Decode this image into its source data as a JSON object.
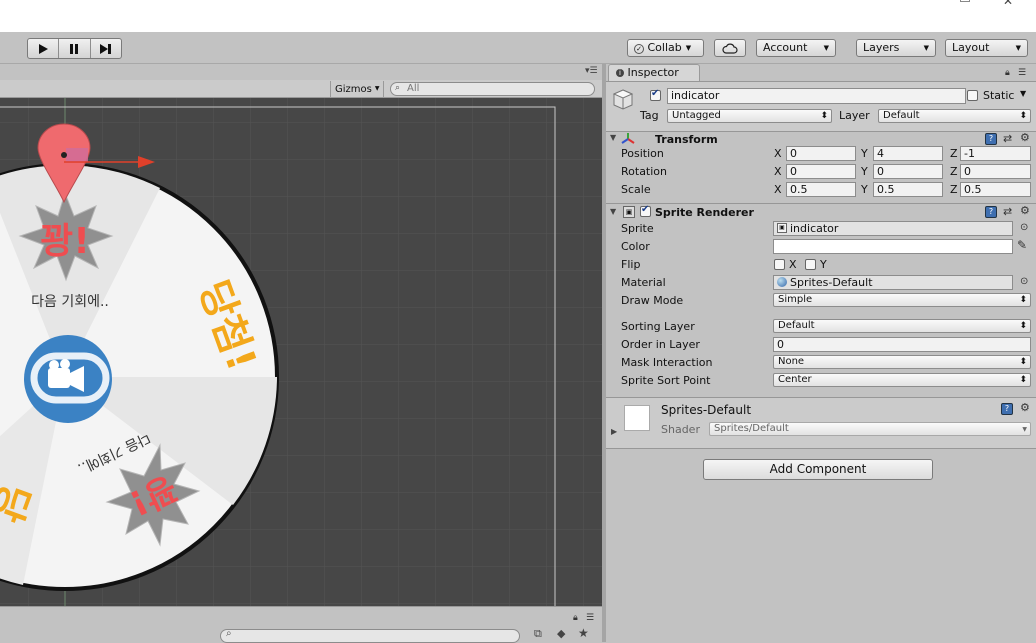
{
  "toolbar": {
    "collab_label": "Collab",
    "account_label": "Account",
    "layers_label": "Layers",
    "layout_label": "Layout"
  },
  "scene": {
    "gizmos_label": "Gizmos",
    "search_placeholder": "All"
  },
  "canvas": {
    "jackpot_text": "꽝!",
    "next_time_text": "다음 기회에..",
    "win_text": "당첨!",
    "next_time_text_2": "다음 기회에..",
    "jackpot_text_2": "꽝!",
    "partial_win_text": "당"
  },
  "inspector": {
    "tab_label": "Inspector",
    "object": {
      "name": "indicator",
      "static_label": "Static",
      "tag_label": "Tag",
      "tag_value": "Untagged",
      "layer_label": "Layer",
      "layer_value": "Default"
    },
    "transform": {
      "title": "Transform",
      "position_label": "Position",
      "rotation_label": "Rotation",
      "scale_label": "Scale",
      "axis_x": "X",
      "axis_y": "Y",
      "axis_z": "Z",
      "position": {
        "x": "0",
        "y": "4",
        "z": "-1"
      },
      "rotation": {
        "x": "0",
        "y": "0",
        "z": "0"
      },
      "scale": {
        "x": "0.5",
        "y": "0.5",
        "z": "0.5"
      }
    },
    "sprite_renderer": {
      "title": "Sprite Renderer",
      "sprite_label": "Sprite",
      "sprite_value": "indicator",
      "color_label": "Color",
      "flip_label": "Flip",
      "flip_x": "X",
      "flip_y": "Y",
      "material_label": "Material",
      "material_value": "Sprites-Default",
      "draw_mode_label": "Draw Mode",
      "draw_mode_value": "Simple",
      "sorting_layer_label": "Sorting Layer",
      "sorting_layer_value": "Default",
      "order_label": "Order in Layer",
      "order_value": "0",
      "mask_label": "Mask Interaction",
      "mask_value": "None",
      "sort_point_label": "Sprite Sort Point",
      "sort_point_value": "Center"
    },
    "material": {
      "name": "Sprites-Default",
      "shader_label": "Shader",
      "shader_value": "Sprites/Default"
    },
    "add_component_label": "Add Component"
  }
}
